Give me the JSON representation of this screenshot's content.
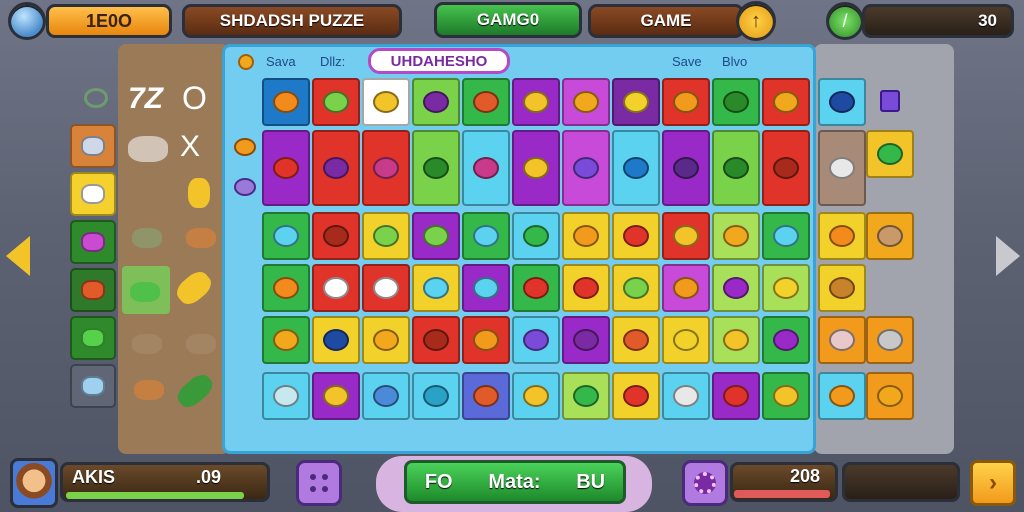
{
  "header": {
    "score_value": "1E0O",
    "title": "SHDADSH PUZZE",
    "mode_label": "GAMG0",
    "game_label": "GAME",
    "right_value": "30",
    "colors": {
      "accent_orange": "#f39a1c",
      "accent_green": "#3fb341",
      "title_bg": "#6a3a1c"
    }
  },
  "board": {
    "left_header_a": "Sava",
    "left_header_b": "Dllz:",
    "banner": "UHDAHESHO",
    "right_header_a": "Save",
    "right_header_b": "Blvo",
    "side_marks": [
      "7Z",
      "O",
      "X"
    ]
  },
  "footer": {
    "player_name": "AKIS",
    "player_value": ".09",
    "center_button_left": "FO",
    "center_button_mid": "Mata:",
    "center_button_right": "BU",
    "right_score": "208"
  }
}
